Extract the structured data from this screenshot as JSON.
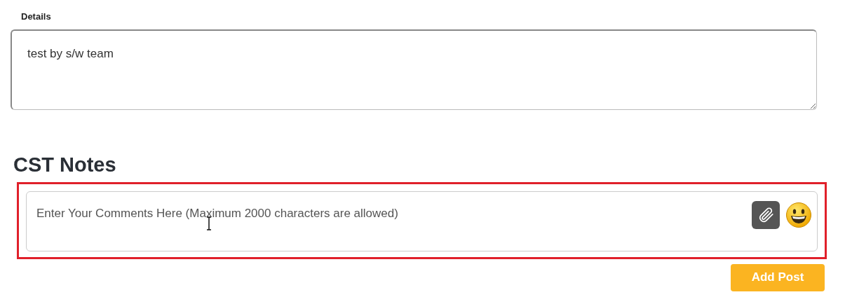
{
  "details": {
    "label": "Details",
    "value": "test by s/w team"
  },
  "notes": {
    "title": "CST Notes",
    "placeholder": "Enter Your Comments Here (Maximum 2000 characters are allowed)",
    "highlighted": true
  },
  "buttons": [
    "Add Post"
  ]
}
